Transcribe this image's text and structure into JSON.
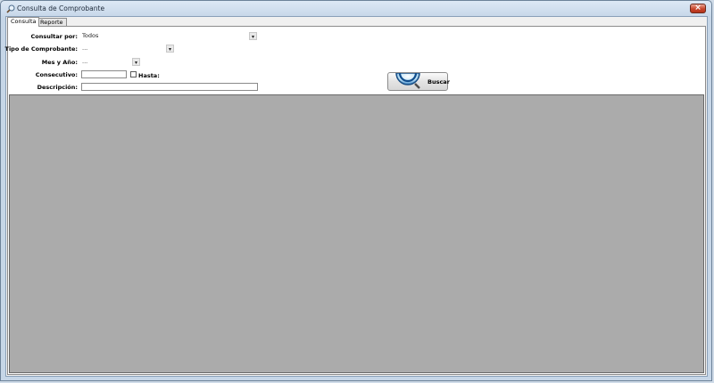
{
  "window": {
    "title": "Consulta de Comprobante",
    "close_symbol": "×"
  },
  "tabs": [
    {
      "label": "Consulta",
      "active": true
    },
    {
      "label": "Reporte",
      "active": false
    }
  ],
  "form": {
    "consultar_por": {
      "label": "Consultar por:",
      "value": "Todos"
    },
    "tipo_comprobante": {
      "label": "Tipo de Comprobante:",
      "value": "..."
    },
    "mes_anio": {
      "label": "Mes y Año:",
      "value": "..."
    },
    "consecutivo": {
      "label": "Consecutivo:",
      "value": ""
    },
    "hasta": {
      "label": "Hasta:",
      "checked": false
    },
    "descripcion": {
      "label": "Descripción:",
      "value": ""
    }
  },
  "buscar_button": {
    "label": "Buscar",
    "icon": "magnifier-icon"
  },
  "combo_arrow": "▾",
  "colors": {
    "grid_background": "#ababab",
    "window_frame": "#c6d6e7"
  }
}
